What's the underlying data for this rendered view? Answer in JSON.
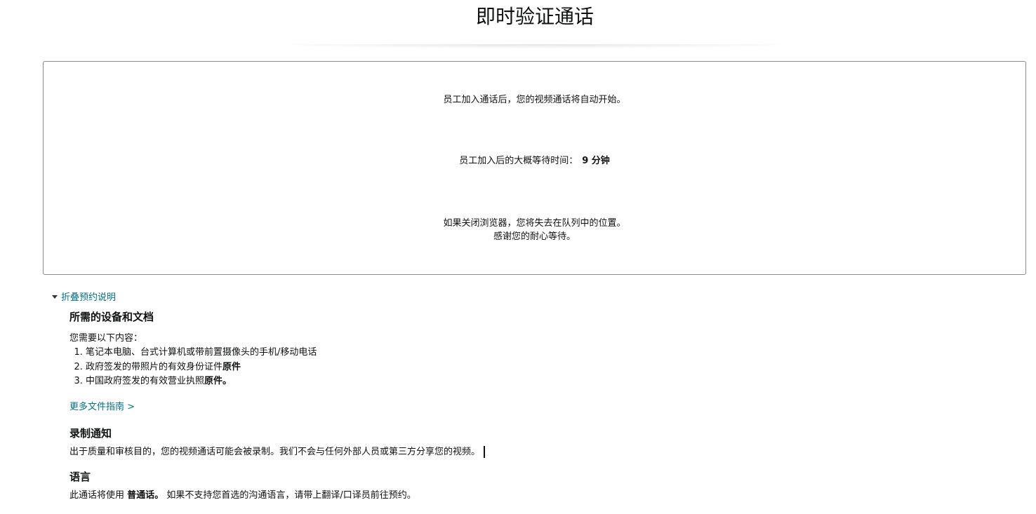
{
  "header": {
    "title": "即时验证通话"
  },
  "status_box": {
    "auto_start": "员工加入通话后，您的视频通话将自动开始。",
    "wait_label": "员工加入后的大概等待时间：",
    "wait_value": "9 分钟",
    "close_warning": "如果关闭浏览器，您将失去在队列中的位置。",
    "thanks": "感谢您的耐心等待。"
  },
  "instructions": {
    "toggle_label": "折叠预约说明",
    "equipment": {
      "heading": "所需的设备和文档",
      "intro": "您需要以下内容：",
      "items": [
        {
          "text": "笔记本电脑、台式计算机或带前置摄像头的手机/移动电话",
          "bold": ""
        },
        {
          "text": "政府签发的带照片的有效身份证件",
          "bold": "原件"
        },
        {
          "text": "中国政府签发的有效营业执照",
          "bold": "原件。"
        }
      ],
      "more_link": "更多文件指南 >"
    },
    "recording": {
      "heading": "录制通知",
      "text": "出于质量和审核目的，您的视频通话可能会被录制。我们不会与任何外部人员或第三方分享您的视频。"
    },
    "language": {
      "heading": "语言",
      "prefix": "此通话将使用",
      "language": "普通话。",
      "suffix": "如果不支持您首选的沟通语言，请带上翻译/口译员前往预约。"
    }
  }
}
